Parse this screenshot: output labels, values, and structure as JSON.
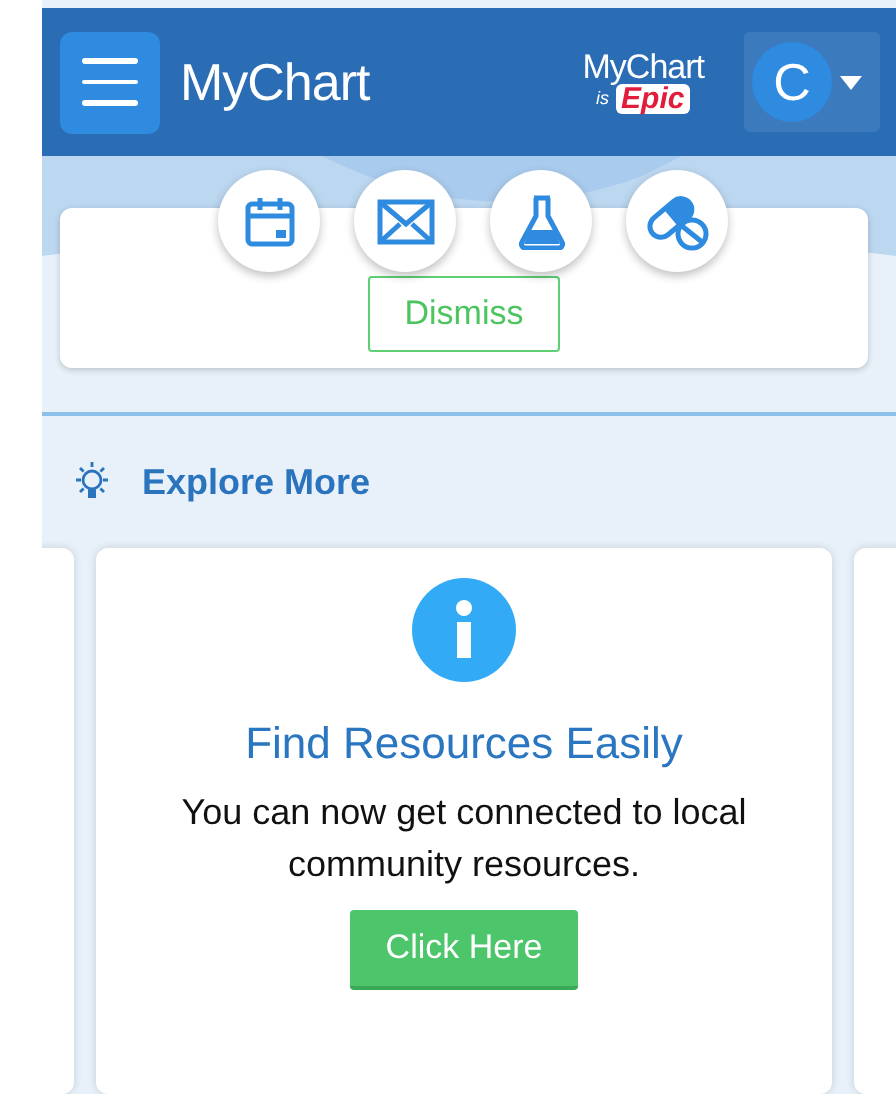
{
  "header": {
    "logo": "MyChart",
    "brand_logo": {
      "name": "MyChart",
      "is": "is",
      "vendor": "Epic"
    },
    "avatar_initial": "C"
  },
  "quick_actions": [
    {
      "kind": "calendar"
    },
    {
      "kind": "mail"
    },
    {
      "kind": "flask"
    },
    {
      "kind": "pill"
    }
  ],
  "notice": {
    "button": "Dismiss"
  },
  "explore": {
    "title": "Explore More",
    "cards": [
      {
        "kind": "partial"
      },
      {
        "kind": "full",
        "title": "Find Resources Easily",
        "text": "You can now get connected to local community resources.",
        "button": "Click Here"
      },
      {
        "kind": "partial"
      }
    ]
  }
}
